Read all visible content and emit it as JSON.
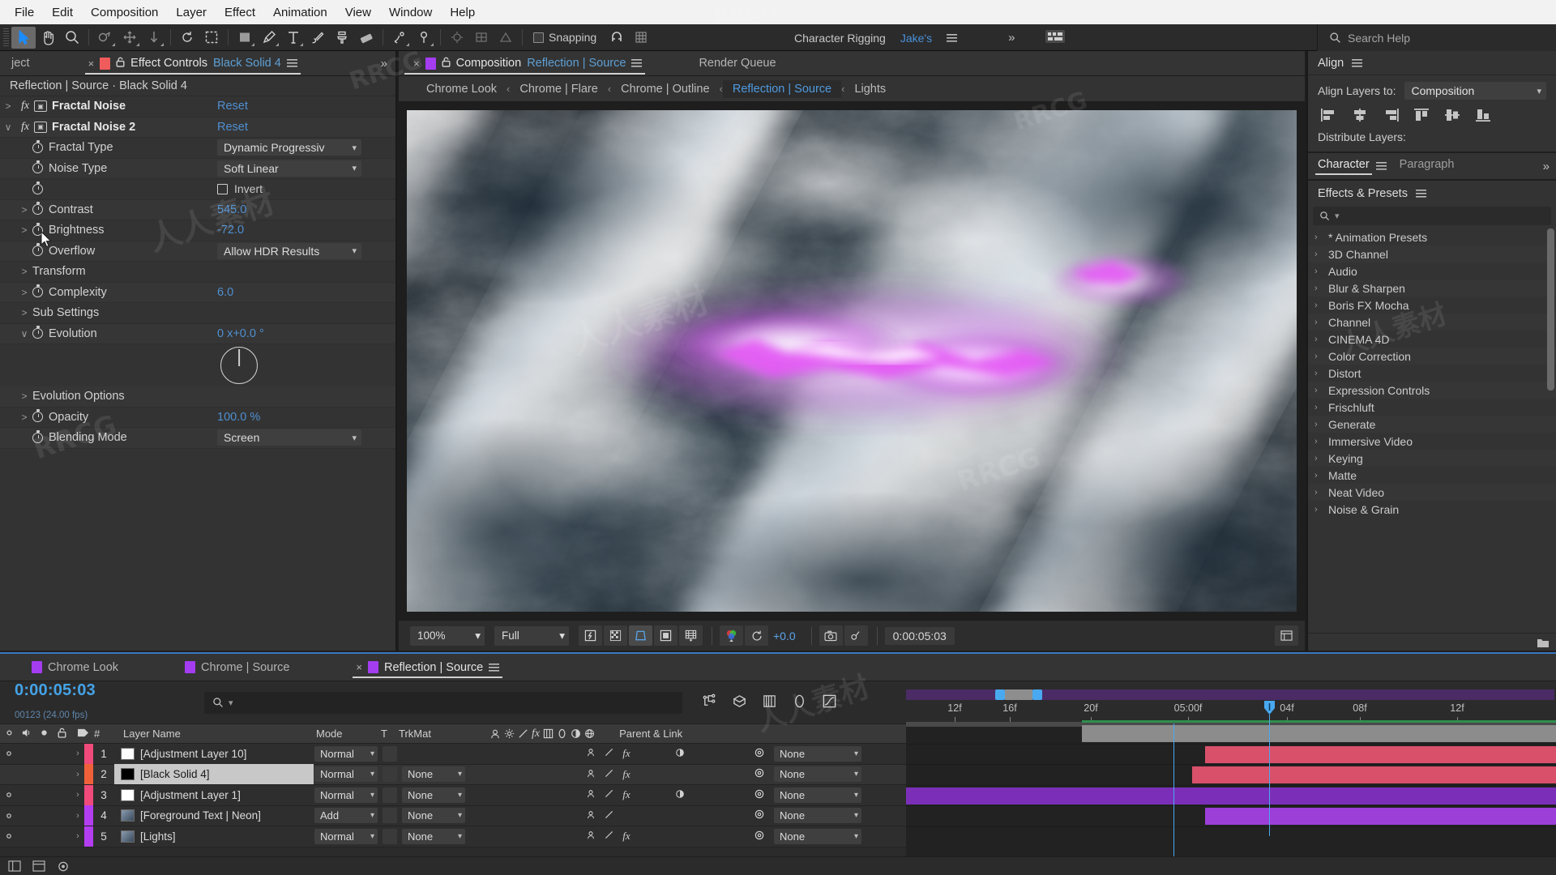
{
  "menubar": {
    "items": [
      "File",
      "Edit",
      "Composition",
      "Layer",
      "Effect",
      "Animation",
      "View",
      "Window",
      "Help"
    ]
  },
  "toolbar": {
    "snapping_label": "Snapping",
    "workspace_label": "Character Rigging",
    "workspace_user": "Jake's",
    "search_help_placeholder": "Search Help"
  },
  "effect_controls": {
    "tab_label": "Effect Controls",
    "tab_target": "Black Solid 4",
    "header": "Reflection | Source · Black Solid 4",
    "rows": [
      {
        "type": "effect",
        "twirl": ">",
        "label": "Fractal Noise",
        "value": "Reset",
        "vclass": "blue"
      },
      {
        "type": "effect",
        "twirl": "∨",
        "label": "Fractal Noise 2",
        "value": "Reset",
        "vclass": "blue"
      },
      {
        "type": "dropdown",
        "twirl": "",
        "label": "Fractal Type",
        "value": "Dynamic Progressiv"
      },
      {
        "type": "dropdown",
        "twirl": "",
        "label": "Noise Type",
        "value": "Soft Linear"
      },
      {
        "type": "checkbox",
        "twirl": "",
        "label": "",
        "value": "Invert"
      },
      {
        "type": "prop",
        "twirl": ">",
        "label": "Contrast",
        "value": "545.0",
        "vclass": "blue"
      },
      {
        "type": "prop",
        "twirl": ">",
        "label": "Brightness",
        "value": "-72.0",
        "vclass": "blue"
      },
      {
        "type": "dropdown",
        "twirl": "",
        "label": "Overflow",
        "value": "Allow HDR Results"
      },
      {
        "type": "group",
        "twirl": ">",
        "label": "Transform",
        "value": ""
      },
      {
        "type": "prop",
        "twirl": ">",
        "label": "Complexity",
        "value": "6.0",
        "vclass": "blue"
      },
      {
        "type": "group",
        "twirl": ">",
        "label": "Sub Settings",
        "value": ""
      },
      {
        "type": "prop",
        "twirl": "∨",
        "label": "Evolution",
        "value": "0 x+0.0 °",
        "vclass": "blue"
      },
      {
        "type": "dial",
        "twirl": "",
        "label": "",
        "value": ""
      },
      {
        "type": "group",
        "twirl": ">",
        "label": "Evolution Options",
        "value": ""
      },
      {
        "type": "prop",
        "twirl": ">",
        "label": "Opacity",
        "value": "100.0 %",
        "vclass": "blue"
      },
      {
        "type": "dropdown",
        "twirl": "",
        "label": "Blending Mode",
        "value": "Screen"
      }
    ]
  },
  "composition": {
    "tab_label": "Composition",
    "tab_comp_name": "Reflection | Source",
    "render_queue_label": "Render Queue",
    "breadcrumbs": [
      {
        "label": "Chrome Look",
        "selected": false
      },
      {
        "label": "Chrome | Flare",
        "selected": false
      },
      {
        "label": "Chrome | Outline",
        "selected": false
      },
      {
        "label": "Reflection | Source",
        "selected": true
      },
      {
        "label": "Lights",
        "selected": false
      }
    ],
    "viewer_bottom": {
      "zoom": "100%",
      "resolution": "Full",
      "exposure": "+0.0",
      "timecode": "0:00:05:03"
    }
  },
  "right": {
    "align": {
      "title": "Align",
      "align_layers_to_label": "Align Layers to:",
      "align_layers_to_value": "Composition",
      "distribute_label": "Distribute Layers:"
    },
    "character": {
      "tabs": [
        "Character",
        "Paragraph"
      ],
      "selected": "Character"
    },
    "effects_presets": {
      "title": "Effects & Presets",
      "search_placeholder": "",
      "items": [
        "* Animation Presets",
        "3D Channel",
        "Audio",
        "Blur & Sharpen",
        "Boris FX Mocha",
        "Channel",
        "CINEMA 4D",
        "Color Correction",
        "Distort",
        "Expression Controls",
        "Frischluft",
        "Generate",
        "Immersive Video",
        "Keying",
        "Matte",
        "Neat Video",
        "Noise & Grain"
      ]
    }
  },
  "timeline": {
    "tabs": [
      {
        "label": "Chrome Look",
        "selected": false
      },
      {
        "label": "Chrome | Source",
        "selected": false
      },
      {
        "label": "Reflection | Source",
        "selected": true
      }
    ],
    "current_time": "0:00:05:03",
    "frame_info": "00123 (24.00 fps)",
    "search_placeholder": "",
    "columns": [
      "#",
      "Layer Name",
      "Mode",
      "T",
      "TrkMat",
      "Parent & Link"
    ],
    "layers": [
      {
        "index": "1",
        "name": "[Adjustment Layer 10]",
        "mode": "Normal",
        "trkmat": "",
        "parent": "None",
        "color": "#f04a7a",
        "swatch": "#ffffff",
        "has_thumb": false,
        "fx": true,
        "matte": true,
        "eye": true
      },
      {
        "index": "2",
        "name": "[Black Solid 4]",
        "mode": "Normal",
        "trkmat": "None",
        "parent": "None",
        "color": "#f0613a",
        "swatch": "#000000",
        "has_thumb": false,
        "fx": true,
        "matte": false,
        "eye": false,
        "selected": true
      },
      {
        "index": "3",
        "name": "[Adjustment Layer 1]",
        "mode": "Normal",
        "trkmat": "None",
        "parent": "None",
        "color": "#f04a7a",
        "swatch": "#ffffff",
        "has_thumb": false,
        "fx": true,
        "matte": true,
        "eye": true
      },
      {
        "index": "4",
        "name": "[Foreground Text | Neon]",
        "mode": "Add",
        "trkmat": "None",
        "parent": "None",
        "color": "#b33df0",
        "swatch": "#556070",
        "has_thumb": true,
        "fx": false,
        "matte": false,
        "eye": true
      },
      {
        "index": "5",
        "name": "[Lights]",
        "mode": "Normal",
        "trkmat": "None",
        "parent": "None",
        "color": "#b33df0",
        "swatch": "#556070",
        "has_thumb": true,
        "fx": true,
        "matte": false,
        "eye": true
      }
    ],
    "ruler_labels": [
      "12f",
      "16f",
      "20f",
      "05:00f",
      "04f",
      "08f",
      "12f"
    ],
    "bars": [
      {
        "row": 0,
        "left": "27%",
        "width": "73%",
        "color": "#8c8c8c"
      },
      {
        "row": 1,
        "left": "46%",
        "width": "54%",
        "color": "#d8506a"
      },
      {
        "row": 2,
        "left": "44%",
        "width": "56%",
        "color": "#d8506a"
      },
      {
        "row": 3,
        "left": "0%",
        "width": "100%",
        "color": "#7b2fb8"
      },
      {
        "row": 4,
        "left": "46%",
        "width": "54%",
        "color": "#9b3fd8"
      }
    ]
  },
  "icons": {
    "search": "search-icon",
    "hamburger": "panel-menu-icon",
    "chevron_down": "chevron-down-icon",
    "lock": "lock-icon"
  },
  "colors": {
    "accent_blue": "#4f8fd0",
    "timecode_blue": "#44a3e8",
    "panel_bg": "#333333",
    "timeline_bg": "#2b2b2b"
  }
}
